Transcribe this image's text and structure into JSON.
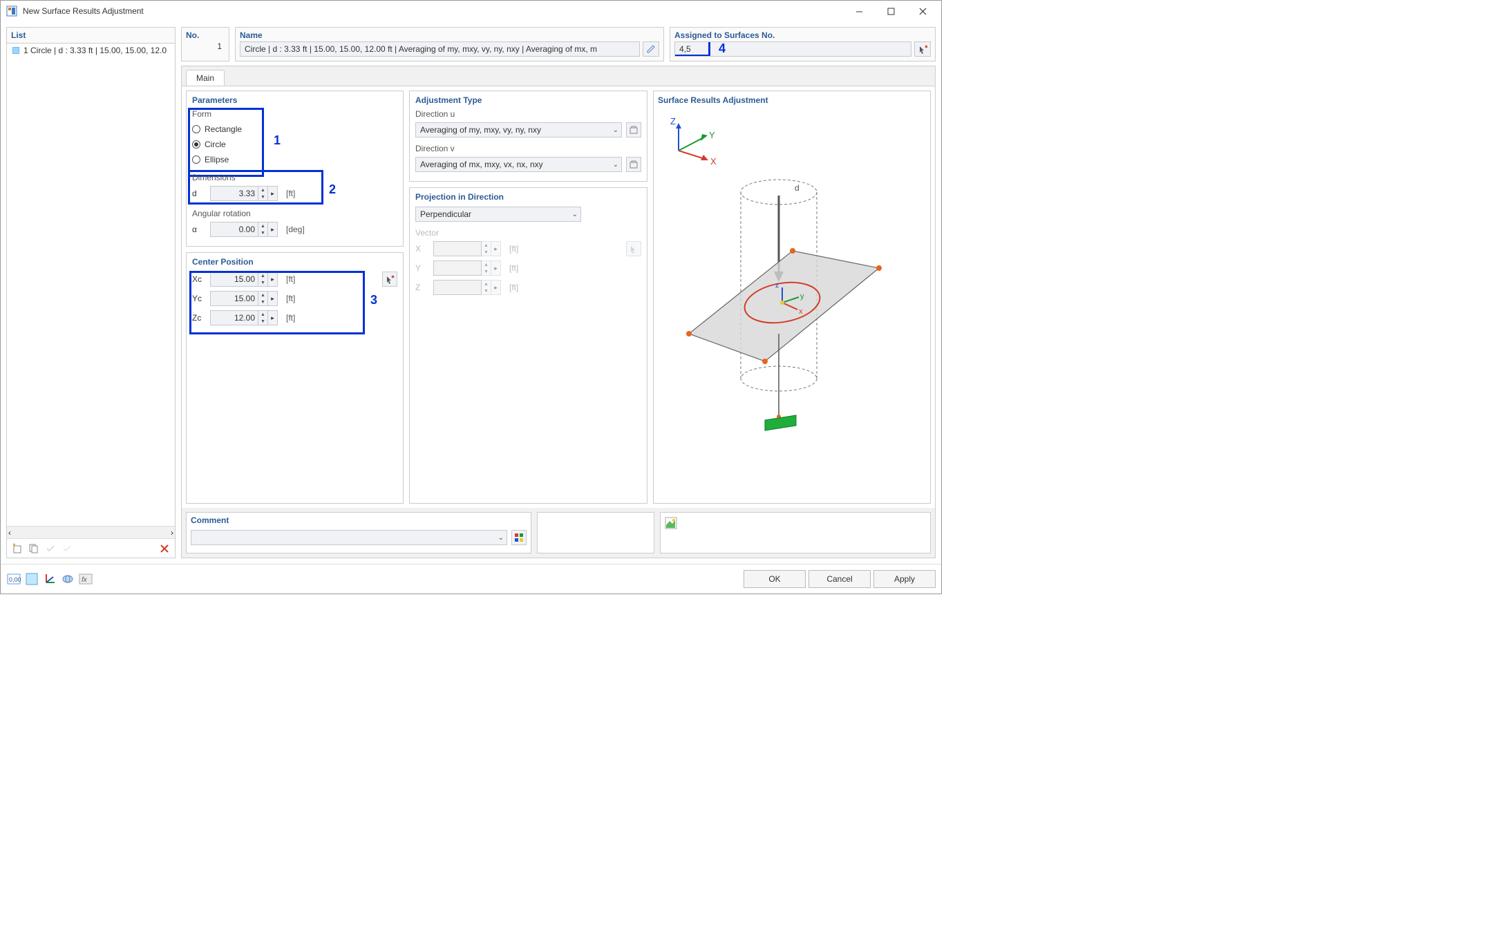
{
  "window": {
    "title": "New Surface Results Adjustment"
  },
  "toprow": {
    "no_label": "No.",
    "no_value": "1",
    "name_label": "Name",
    "name_value": "Circle | d : 3.33 ft | 15.00, 15.00, 12.00 ft | Averaging of my, mxy, vy, ny, nxy | Averaging of mx, m",
    "assigned_label": "Assigned to Surfaces No.",
    "assigned_value": "4,5"
  },
  "list": {
    "header": "List",
    "items": [
      "1 Circle | d : 3.33 ft | 15.00, 15.00, 12.0"
    ]
  },
  "tabs": {
    "main": "Main"
  },
  "parameters": {
    "header": "Parameters",
    "form_header": "Form",
    "form_options": {
      "rectangle": "Rectangle",
      "circle": "Circle",
      "ellipse": "Ellipse"
    },
    "dimensions_header": "Dimensions",
    "d_label": "d",
    "d_value": "3.33",
    "d_unit": "[ft]",
    "angular_header": "Angular rotation",
    "alpha_label": "α",
    "alpha_value": "0.00",
    "alpha_unit": "[deg]"
  },
  "adjustment": {
    "header": "Adjustment Type",
    "diru_label": "Direction u",
    "diru_value": "Averaging of my, mxy, vy, ny, nxy",
    "dirv_label": "Direction v",
    "dirv_value": "Averaging of mx, mxy, vx, nx, nxy"
  },
  "center": {
    "header": "Center Position",
    "xc": "Xc",
    "xc_v": "15.00",
    "yc": "Yc",
    "yc_v": "15.00",
    "zc": "Zc",
    "zc_v": "12.00",
    "unit": "[ft]"
  },
  "projection": {
    "header": "Projection in Direction",
    "value": "Perpendicular",
    "vector_header": "Vector",
    "x": "X",
    "y": "Y",
    "z": "Z",
    "unit": "[ft]"
  },
  "preview": {
    "header": "Surface Results Adjustment"
  },
  "comment": {
    "header": "Comment"
  },
  "buttons": {
    "ok": "OK",
    "cancel": "Cancel",
    "apply": "Apply"
  },
  "annotations": {
    "n1": "1",
    "n2": "2",
    "n3": "3",
    "n4": "4"
  }
}
